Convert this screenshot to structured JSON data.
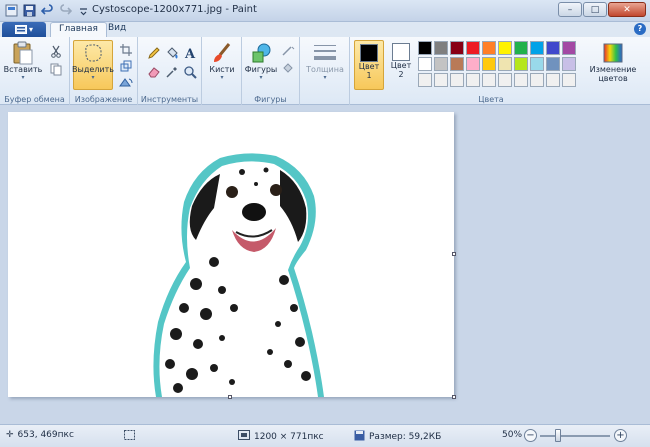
{
  "window": {
    "title": "Cystoscope-1200x771.jpg - Paint",
    "minimize": "–",
    "maximize": "□",
    "close": "✕"
  },
  "tabs": {
    "app_menu_glyph": "▾",
    "home": "Главная",
    "view": "Вид",
    "help": "?"
  },
  "ribbon": {
    "clipboard": {
      "paste": "Вставить",
      "group_label": "Буфер обмена"
    },
    "image": {
      "select": "Выделить",
      "group_label": "Изображение"
    },
    "tools": {
      "group_label": "Инструменты"
    },
    "brushes": {
      "label": "Кисти"
    },
    "shapes": {
      "label": "Фигуры",
      "group_label": "Фигуры"
    },
    "size": {
      "label": "Толщина"
    },
    "colors": {
      "color1": "Цвет 1",
      "color1_line1": "Цвет",
      "color1_line2": "1",
      "color2_line1": "Цвет",
      "color2_line2": "2",
      "edit": "Изменение цветов",
      "edit_line1": "Изменение",
      "edit_line2": "цветов",
      "group_label": "Цвета",
      "color1_value": "#000000",
      "color2_value": "#ffffff",
      "palette": [
        "#000000",
        "#7f7f7f",
        "#880015",
        "#ed1c24",
        "#ff7f27",
        "#fff200",
        "#22b14c",
        "#00a2e8",
        "#3f48cc",
        "#a349a4",
        "#ffffff",
        "#c3c3c3",
        "#b97a57",
        "#ffaec9",
        "#ffc90e",
        "#efe4b0",
        "#b5e61d",
        "#99d9ea",
        "#7092be",
        "#c8bfe7",
        "#f0f0f0",
        "#f0f0f0",
        "#f0f0f0",
        "#f0f0f0",
        "#f0f0f0",
        "#f0f0f0",
        "#f0f0f0",
        "#f0f0f0",
        "#f0f0f0",
        "#f0f0f0"
      ]
    }
  },
  "status": {
    "cursor": "653, 469пкс",
    "dimensions": "1200 × 771пкс",
    "file_size": "Размер: 59,2КБ",
    "zoom": "50%",
    "zoom_level": 0.5
  }
}
